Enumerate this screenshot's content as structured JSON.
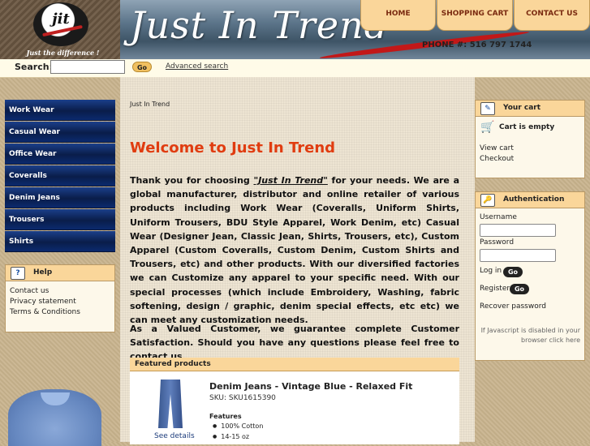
{
  "header": {
    "logo_text": "jit",
    "logo_tagline": "Just the difference !",
    "banner_title": "Just In Trend",
    "phone": "PHONE #: 516 797 1744",
    "nav": {
      "home": "HOME",
      "cart": "SHOPPING CART",
      "contact": "CONTACT US"
    }
  },
  "search": {
    "label": "Search:",
    "value": "",
    "go": "Go",
    "advanced": "Advanced search"
  },
  "categories": [
    "Work Wear",
    "Casual Wear",
    "Office Wear",
    "Coveralls",
    "Denim Jeans",
    "Trousers",
    "Shirts"
  ],
  "help": {
    "title": "Help",
    "links": [
      "Contact us",
      "Privacy statement",
      "Terms & Conditions"
    ]
  },
  "main": {
    "breadcrumb": "Just In Trend",
    "welcome": "Welcome to Just In Trend",
    "intro_lead": "Thank you for choosing ",
    "intro_brand": "\"Just In Trend\"",
    "intro_rest": " for your needs. We are a global manufacturer, distributor and online retailer of various products including Work Wear (Coveralls, Uniform Shirts, Uniform Trousers, BDU Style Apparel, Work Denim, etc) Casual Wear (Designer Jean, Classic Jean, Shirts, Trousers, etc), Custom Apparel (Custom Coveralls, Custom Denim, Custom Shirts and Trousers, etc) and other products. With our diversified factories we can Customize any apparel to your specific need. With our special processes (which include Embroidery, Washing, fabric softening, design / graphic, denim special effects, etc etc) we can meet any customization needs.",
    "guarantee": "As a Valued Customer, we guarantee complete Customer Satisfaction. Should you have any questions please feel free to contact us.",
    "featured_title": "Featured products",
    "product": {
      "name": "Denim Jeans - Vintage Blue - Relaxed Fit",
      "sku": "SKU: SKU1615390",
      "features_label": "Features",
      "features": [
        "100% Cotton",
        "14-15 oz"
      ],
      "see_details": "See details"
    }
  },
  "cart": {
    "title": "Your cart",
    "status": "Cart is empty",
    "view": "View cart",
    "checkout": "Checkout"
  },
  "auth": {
    "title": "Authentication",
    "username_label": "Username",
    "password_label": "Password",
    "login": "Log in",
    "register": "Register",
    "go": "Go",
    "recover": "Recover password",
    "js_note": "If Javascript is disabled in your browser click here"
  }
}
